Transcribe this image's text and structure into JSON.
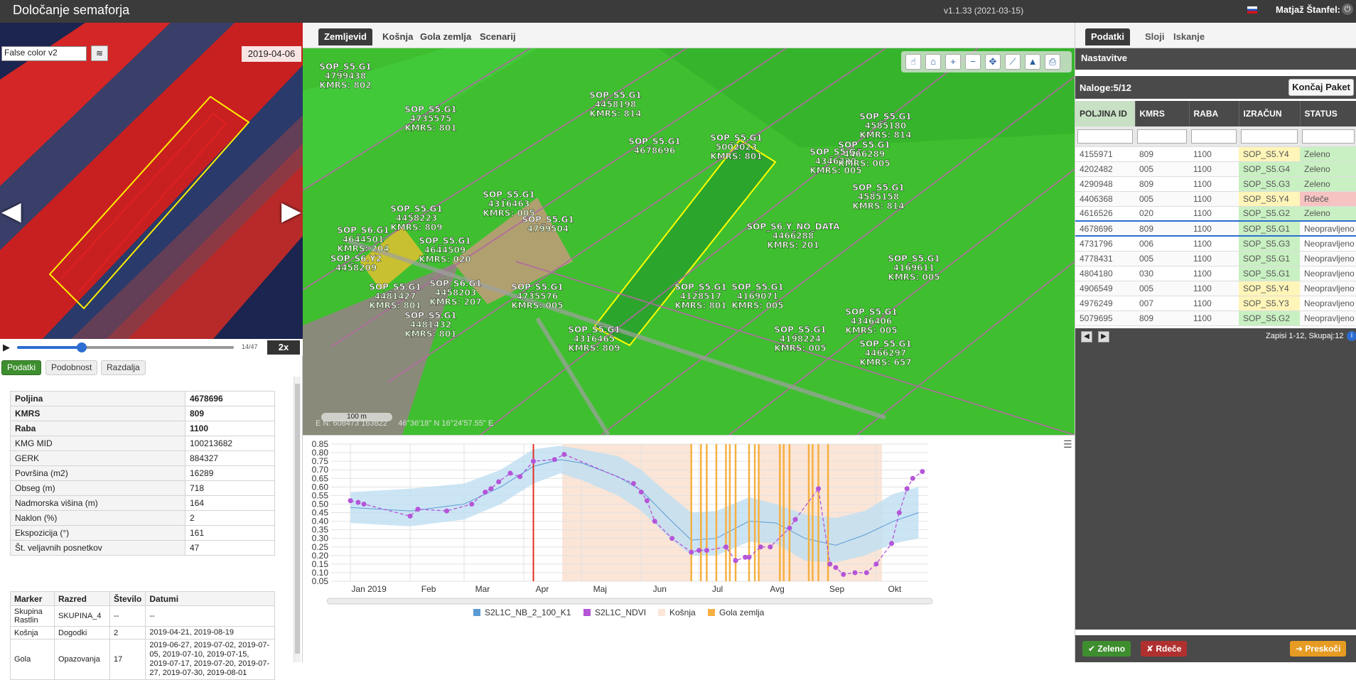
{
  "header": {
    "title": "Določanje semaforja",
    "version": "v1.1.33 (2021-03-15)",
    "user": "Matjaž Štanfel:"
  },
  "left": {
    "layer_select": "False color v2",
    "image_date": "2019-04-06",
    "frame_counter": "14/47",
    "frame_fraction": 0.2979,
    "speed": "2x",
    "tabs": [
      "Podatki",
      "Podobnost",
      "Razdalja"
    ],
    "attributes": [
      {
        "label": "Poljina",
        "value": "4678696",
        "bold": true
      },
      {
        "label": "KMRS",
        "value": "809",
        "bold": true
      },
      {
        "label": "Raba",
        "value": "1100",
        "bold": true
      },
      {
        "label": "KMG MID",
        "value": "100213682"
      },
      {
        "label": "GERK",
        "value": "884327"
      },
      {
        "label": "Površina (m2)",
        "value": "16289"
      },
      {
        "label": "Obseg (m)",
        "value": "718"
      },
      {
        "label": "Nadmorska višina (m)",
        "value": "164"
      },
      {
        "label": "Naklon (%)",
        "value": "2"
      },
      {
        "label": "Ekspozicija (°)",
        "value": "161"
      },
      {
        "label": "Št. veljavnih posnetkov",
        "value": "47"
      }
    ],
    "marker_headers": [
      "Marker",
      "Razred",
      "Število",
      "Datumi"
    ],
    "markers": [
      {
        "marker": "Skupina Rastlin",
        "razred": "SKUPINA_4",
        "stevilo": "--",
        "datumi": "--"
      },
      {
        "marker": "Košnja",
        "razred": "Dogodki",
        "stevilo": "2",
        "datumi": "2019-04-21, 2019-08-19"
      },
      {
        "marker": "Gola",
        "razred": "Opazovanja",
        "stevilo": "17",
        "datumi": "2019-06-27, 2019-07-02, 2019-07-05, 2019-07-10, 2019-07-15, 2019-07-17, 2019-07-20, 2019-07-27, 2019-07-30, 2019-08-01"
      }
    ]
  },
  "map": {
    "tabs": [
      "Zemljevid",
      "Košnja",
      "Gola zemlja",
      "Scenarij"
    ],
    "scale": "100 m",
    "coords_en": "E N: 608473 163822",
    "coords_ll": "46°36'18\" N 16°24'57.55\" E",
    "labels": [
      {
        "c": "SOP_S5.G1",
        "id": "4799438",
        "k": "KMRS: 802"
      },
      {
        "c": "SOP_S5.G1",
        "id": "4735575",
        "k": "KMRS: 801"
      },
      {
        "c": "SOP_S5.G1",
        "id": "4458198",
        "k": "KMRS: 814"
      },
      {
        "c": "SOP_S5.G1",
        "id": "5002023",
        "k": "KMRS: 801"
      },
      {
        "c": "SOP_S5.G1",
        "id": "4678696",
        "k": ""
      },
      {
        "c": "SOP_S5.G1",
        "id": "4316463",
        "k": "KMRS: 005"
      },
      {
        "c": "SOP_S5.G1",
        "id": "4799504",
        "k": ""
      },
      {
        "c": "SOP_S5.G1",
        "id": "4458223",
        "k": "KMRS: 809"
      },
      {
        "c": "SOP_S6.G1",
        "id": "4644501",
        "k": "KMRS: 204"
      },
      {
        "c": "SOP_S5.G1",
        "id": "4644509",
        "k": "KMRS: 020"
      },
      {
        "c": "SOP_S6.Y2",
        "id": "4458209",
        "k": ""
      },
      {
        "c": "SOP_S5.G1",
        "id": "4481427",
        "k": "KMRS: 801"
      },
      {
        "c": "SOP_S6.G1",
        "id": "4458203",
        "k": "KMRS: 207"
      },
      {
        "c": "SOP_S5.G1",
        "id": "4735576",
        "k": "KMRS: 005"
      },
      {
        "c": "SOP_S5.G1",
        "id": "4128517",
        "k": "KMRS: 801"
      },
      {
        "c": "SOP_S5.G1",
        "id": "4169071",
        "k": "KMRS: 005"
      },
      {
        "c": "SOP_S5.G1",
        "id": "4169611",
        "k": "KMRS: 005"
      },
      {
        "c": "SOP_S5.G1",
        "id": "4346390",
        "k": "KMRS: 005"
      },
      {
        "c": "SOP_S5.G1",
        "id": "4585180",
        "k": "KMRS: 814"
      },
      {
        "c": "SOP_S5.G1",
        "id": "4466289",
        "k": "KMRS: 005"
      },
      {
        "c": "SOP_S5.G1",
        "id": "4585158",
        "k": "KMRS: 814"
      },
      {
        "c": "SOP_S6.Y_NO_DATA",
        "id": "4466288",
        "k": "KMRS: 201"
      },
      {
        "c": "SOP_S5.G1",
        "id": "4481432",
        "k": "KMRS: 801"
      },
      {
        "c": "SOP_S5.G1",
        "id": "4316465",
        "k": "KMRS: 809"
      },
      {
        "c": "SOP_S5.G1",
        "id": "4198224",
        "k": "KMRS: 005"
      },
      {
        "c": "SOP_S5.G1",
        "id": "4346406",
        "k": "KMRS: 005"
      },
      {
        "c": "SOP_S5.G1",
        "id": "4466297",
        "k": "KMRS: 657"
      }
    ]
  },
  "chart_data": {
    "type": "line",
    "ylim": [
      0.05,
      0.85
    ],
    "yticks": [
      0.85,
      0.8,
      0.75,
      0.7,
      0.65,
      0.6,
      0.55,
      0.5,
      0.45,
      0.4,
      0.35,
      0.3,
      0.25,
      0.2,
      0.15,
      0.1,
      0.05
    ],
    "xlim": [
      "2018-12-22",
      "2019-10-28"
    ],
    "xticks": [
      {
        "d": "2019-01-01",
        "l": "Jan 2019"
      },
      {
        "d": "2019-02-01",
        "l": "Feb"
      },
      {
        "d": "2019-03-01",
        "l": "Mar"
      },
      {
        "d": "2019-04-01",
        "l": "Apr"
      },
      {
        "d": "2019-05-01",
        "l": "Maj"
      },
      {
        "d": "2019-06-01",
        "l": "Jun"
      },
      {
        "d": "2019-07-01",
        "l": "Jul"
      },
      {
        "d": "2019-08-01",
        "l": "Avg"
      },
      {
        "d": "2019-09-01",
        "l": "Sep"
      },
      {
        "d": "2019-10-01",
        "l": "Okt"
      }
    ],
    "current_date": "2019-04-06",
    "legend": [
      "S2L1C_NB_2_100_K1",
      "S2L1C_NDVI",
      "Košnja",
      "Gola zemlja"
    ],
    "colors": {
      "nb_band": "#bfdff2",
      "nb_line": "#5b9bd5",
      "ndvi": "#b455d8",
      "kosnja": "#fbe5d6",
      "gola": "#f5b041",
      "current": "#e03020"
    },
    "kosnja_periods": [
      [
        "2019-04-21",
        "2019-06-27"
      ],
      [
        "2019-08-01",
        "2019-10-04"
      ]
    ],
    "gola_dates": [
      "2019-06-27",
      "2019-07-02",
      "2019-07-05",
      "2019-07-10",
      "2019-07-15",
      "2019-07-17",
      "2019-07-20",
      "2019-07-27",
      "2019-07-30",
      "2019-08-01",
      "2019-08-12",
      "2019-08-14",
      "2019-08-17",
      "2019-08-27",
      "2019-08-29",
      "2019-09-01",
      "2019-09-06"
    ],
    "nb_series": [
      [
        "2019-01-01",
        0.48,
        0.39,
        0.57
      ],
      [
        "2019-02-01",
        0.46,
        0.37,
        0.59
      ],
      [
        "2019-03-01",
        0.5,
        0.41,
        0.62
      ],
      [
        "2019-03-20",
        0.6,
        0.5,
        0.7
      ],
      [
        "2019-04-06",
        0.72,
        0.62,
        0.82
      ],
      [
        "2019-04-20",
        0.76,
        0.68,
        0.84
      ],
      [
        "2019-05-01",
        0.74,
        0.64,
        0.82
      ],
      [
        "2019-05-20",
        0.66,
        0.55,
        0.78
      ],
      [
        "2019-06-01",
        0.58,
        0.46,
        0.7
      ],
      [
        "2019-06-15",
        0.42,
        0.31,
        0.56
      ],
      [
        "2019-06-27",
        0.29,
        0.2,
        0.45
      ],
      [
        "2019-07-10",
        0.3,
        0.2,
        0.46
      ],
      [
        "2019-07-27",
        0.4,
        0.28,
        0.54
      ],
      [
        "2019-08-10",
        0.39,
        0.27,
        0.5
      ],
      [
        "2019-08-25",
        0.3,
        0.17,
        0.44
      ],
      [
        "2019-09-10",
        0.26,
        0.16,
        0.42
      ],
      [
        "2019-09-25",
        0.32,
        0.2,
        0.46
      ],
      [
        "2019-10-10",
        0.4,
        0.27,
        0.56
      ],
      [
        "2019-10-23",
        0.45,
        0.3,
        0.6
      ]
    ],
    "ndvi_points": [
      [
        "2019-01-01",
        0.52
      ],
      [
        "2019-01-05",
        0.51
      ],
      [
        "2019-01-08",
        0.5
      ],
      [
        "2019-02-01",
        0.43
      ],
      [
        "2019-02-05",
        0.47
      ],
      [
        "2019-02-20",
        0.46
      ],
      [
        "2019-03-05",
        0.5
      ],
      [
        "2019-03-12",
        0.57
      ],
      [
        "2019-03-15",
        0.59
      ],
      [
        "2019-03-19",
        0.63
      ],
      [
        "2019-03-25",
        0.68
      ],
      [
        "2019-03-30",
        0.66
      ],
      [
        "2019-04-06",
        0.75
      ],
      [
        "2019-04-17",
        0.76
      ],
      [
        "2019-04-22",
        0.79
      ],
      [
        "2019-05-28",
        0.62
      ],
      [
        "2019-06-01",
        0.57
      ],
      [
        "2019-06-04",
        0.52
      ],
      [
        "2019-06-08",
        0.4
      ],
      [
        "2019-06-17",
        0.3
      ],
      [
        "2019-06-27",
        0.22
      ],
      [
        "2019-07-01",
        0.23
      ],
      [
        "2019-07-05",
        0.23
      ],
      [
        "2019-07-15",
        0.25
      ],
      [
        "2019-07-20",
        0.17
      ],
      [
        "2019-07-25",
        0.19
      ],
      [
        "2019-07-27",
        0.19
      ],
      [
        "2019-08-02",
        0.25
      ],
      [
        "2019-08-07",
        0.25
      ],
      [
        "2019-08-17",
        0.36
      ],
      [
        "2019-08-20",
        0.41
      ],
      [
        "2019-09-01",
        0.59
      ],
      [
        "2019-09-07",
        0.15
      ],
      [
        "2019-09-10",
        0.13
      ],
      [
        "2019-09-14",
        0.09
      ],
      [
        "2019-09-20",
        0.1
      ],
      [
        "2019-09-26",
        0.1
      ],
      [
        "2019-10-01",
        0.15
      ],
      [
        "2019-10-09",
        0.27
      ],
      [
        "2019-10-13",
        0.45
      ],
      [
        "2019-10-17",
        0.59
      ],
      [
        "2019-10-20",
        0.65
      ],
      [
        "2019-10-25",
        0.69
      ]
    ]
  },
  "right": {
    "tabs": [
      "Podatki",
      "Sloji",
      "Iskanje"
    ],
    "settings": "Nastavitve",
    "naloge": "Naloge:5/12",
    "koncaj": "Končaj Paket",
    "columns": [
      "POLJINA ID",
      "KMRS",
      "RABA",
      "IZRAČUN",
      "STATUS"
    ],
    "rows": [
      {
        "id": "4155971",
        "kmrs": "809",
        "raba": "1100",
        "izr": "SOP_S5.Y4",
        "status": "Zeleno",
        "ic": "yellow",
        "sc": "green"
      },
      {
        "id": "4202482",
        "kmrs": "005",
        "raba": "1100",
        "izr": "SOP_S5.G4",
        "status": "Zeleno",
        "ic": "green",
        "sc": "green"
      },
      {
        "id": "4290948",
        "kmrs": "809",
        "raba": "1100",
        "izr": "SOP_S5.G3",
        "status": "Zeleno",
        "ic": "green",
        "sc": "green"
      },
      {
        "id": "4406368",
        "kmrs": "005",
        "raba": "1100",
        "izr": "SOP_S5.Y4",
        "status": "Rdeče",
        "ic": "yellow",
        "sc": "red"
      },
      {
        "id": "4616526",
        "kmrs": "020",
        "raba": "1100",
        "izr": "SOP_S5.G2",
        "status": "Zeleno",
        "ic": "green",
        "sc": "green"
      },
      {
        "id": "4678696",
        "kmrs": "809",
        "raba": "1100",
        "izr": "SOP_S5.G1",
        "status": "Neopravljeno",
        "ic": "green",
        "sc": "",
        "sel": true
      },
      {
        "id": "4731796",
        "kmrs": "006",
        "raba": "1100",
        "izr": "SOP_S5.G3",
        "status": "Neopravljeno",
        "ic": "green",
        "sc": ""
      },
      {
        "id": "4778431",
        "kmrs": "005",
        "raba": "1100",
        "izr": "SOP_S5.G1",
        "status": "Neopravljeno",
        "ic": "green",
        "sc": ""
      },
      {
        "id": "4804180",
        "kmrs": "030",
        "raba": "1100",
        "izr": "SOP_S5.G1",
        "status": "Neopravljeno",
        "ic": "green",
        "sc": ""
      },
      {
        "id": "4906549",
        "kmrs": "005",
        "raba": "1100",
        "izr": "SOP_S5.Y4",
        "status": "Neopravljeno",
        "ic": "yellow",
        "sc": ""
      },
      {
        "id": "4976249",
        "kmrs": "007",
        "raba": "1100",
        "izr": "SOP_S5.Y3",
        "status": "Neopravljeno",
        "ic": "yellow",
        "sc": ""
      },
      {
        "id": "5079695",
        "kmrs": "809",
        "raba": "1100",
        "izr": "SOP_S5.G2",
        "status": "Neopravljeno",
        "ic": "green",
        "sc": ""
      }
    ],
    "records": "Zapisi 1-12, Skupaj:12",
    "buttons": {
      "zeleno": "Zeleno",
      "rdece": "Rdeče",
      "preskoci": "Preskoči"
    }
  }
}
